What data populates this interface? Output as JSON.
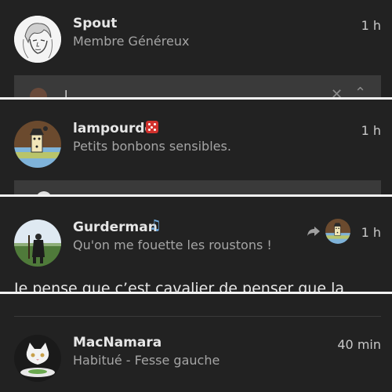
{
  "posts": [
    {
      "username": "Spout",
      "subtitle": "Membre Généreux",
      "time": "1 h",
      "avatar_icon": "sketched-face-avatar",
      "quote_partial_text": "l"
    },
    {
      "username": "lampourde",
      "subtitle": "Petits bonbons sensibles.",
      "time": "1 h",
      "badge_icon": "red-dice-icon",
      "avatar_icon": "domino-figure-avatar"
    },
    {
      "username": "Gurderman",
      "subtitle": "Qu'on me fouette les roustons !",
      "time": "1 h",
      "badge_icon": "music-note-icon",
      "reply_icon": "reply-arrow-icon",
      "avatar_icon": "bearded-man-field-avatar",
      "reply_avatar_icon": "domino-figure-avatar",
      "body_text": "Je pense que c’est cavalier de penser que la"
    },
    {
      "username": "MacNamara",
      "subtitle": "Habitué - Fesse gauche",
      "time": "40 min",
      "avatar_icon": "cat-at-table-avatar"
    }
  ],
  "colors": {
    "background": "#222222",
    "username": "#e6e6e6",
    "subtitle": "#a5a5a5",
    "separator": "#f2f2f2",
    "dice": "#d0312d",
    "music_note": "#6fa8dc"
  }
}
